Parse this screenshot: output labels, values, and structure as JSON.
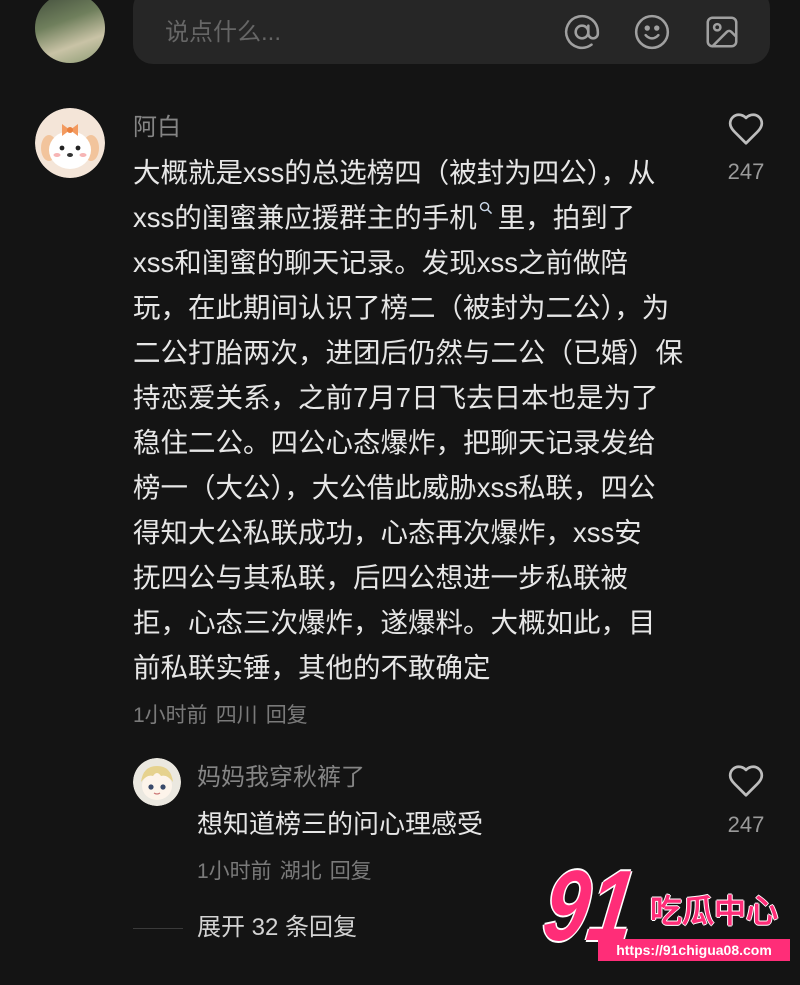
{
  "composer": {
    "placeholder": "说点什么...",
    "icons": {
      "mention": "at-icon",
      "emoji": "emoji-icon",
      "image": "image-icon"
    }
  },
  "comment": {
    "author": "阿白",
    "lines": [
      "大概就是xss的总选榜四（被封为四公），从",
      {
        "before": "xss的闺蜜兼应援群主的手机",
        "after": "里，拍到了"
      },
      "xss和闺蜜的聊天记录。发现xss之前做陪",
      "玩，在此期间认识了榜二（被封为二公），为",
      "二公打胎两次，进团后仍然与二公（已婚）保",
      "持恋爱关系，之前7月7日飞去日本也是为了",
      "稳住二公。四公心态爆炸，把聊天记录发给",
      "榜一（大公），大公借此威胁xss私联，四公",
      "得知大公私联成功，心态再次爆炸，xss安",
      "抚四公与其私联，后四公想进一步私联被",
      "拒，心态三次爆炸，遂爆料。大概如此，目",
      "前私联实锤，其他的不敢确定"
    ],
    "time": "1小时前",
    "location": "四川",
    "reply_label": "回复",
    "likes": "247"
  },
  "reply": {
    "author": "妈妈我穿秋裤了",
    "text": "想知道榜三的问心理感受",
    "time": "1小时前",
    "location": "湖北",
    "reply_label": "回复",
    "likes": "247"
  },
  "expand_label": "展开 32 条回复",
  "watermark": {
    "number": "91",
    "title": "吃瓜中心",
    "url": "https://91chigua08.com"
  },
  "colors": {
    "bg": "#141414",
    "text": "#e6e6e6",
    "muted": "#858585",
    "composer": "#262626",
    "accent": "#ff2d78"
  }
}
